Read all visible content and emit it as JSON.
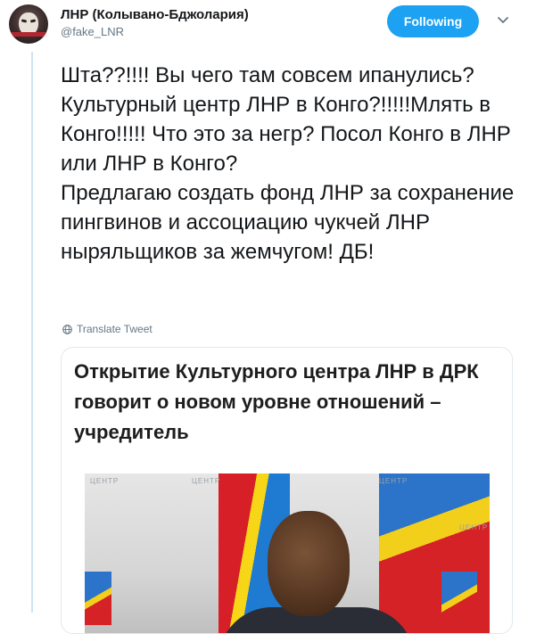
{
  "user": {
    "name": "ЛНР (Колывано-Бджолария)",
    "handle": "@fake_LNR"
  },
  "follow_button": {
    "label": "Following"
  },
  "tweet": {
    "paragraphs": [
      "Шта??!!!! Вы чего там совсем ипанулись? Культурный центр ЛНР в Конго?!!!!!Млять в Конго!!!!! Что  это за негр? Посол Конго в ЛНР или ЛНР в Конго?",
      "Предлагаю создать фонд ЛНР за сохранение пингвинов и ассоциацию чукчей ЛНР ныряльщиков за жемчугом! ДБ!"
    ]
  },
  "translate": {
    "label": "Translate Tweet"
  },
  "card": {
    "title": "Открытие Культурного центра ЛНР в ДРК говорит о новом уровне отношений – учредитель",
    "photo_watermark": "ЦЕНТР"
  },
  "icons": {
    "avatar": "anonymous-mask-avatar",
    "chevron": "chevron-down-icon",
    "globe": "globe-icon"
  },
  "colors": {
    "accent": "#1da1f2",
    "secondary_text": "#657786",
    "thread_line": "#cfe3f1"
  }
}
